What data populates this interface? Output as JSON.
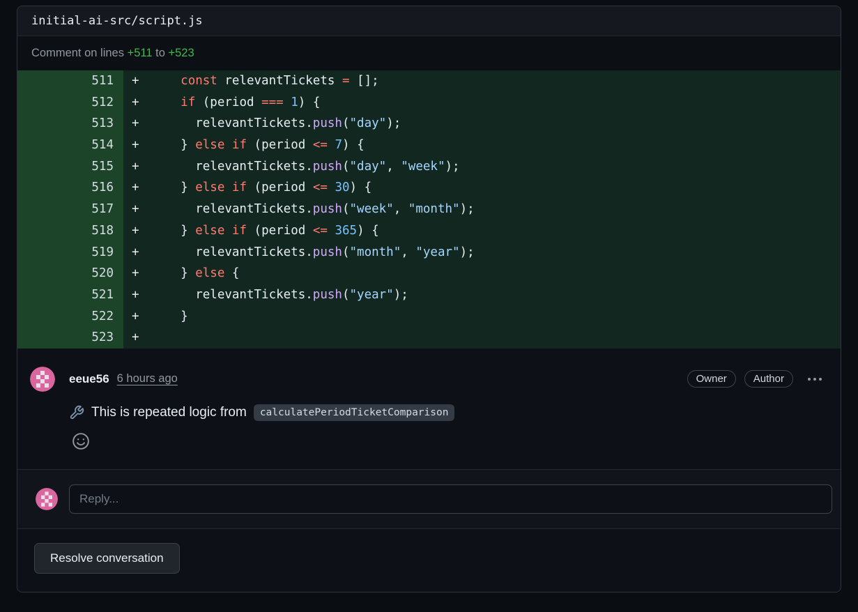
{
  "colors": {
    "addition_green": "#3fb950",
    "addition_line_bg": "#12271f",
    "addition_gutter_bg": "#1c4428",
    "keyword_red": "#ff7b72",
    "string_blue": "#a5d6ff",
    "number_blue": "#79c0fd",
    "function_purple": "#d2a8ff",
    "avatar_pink": "#d9669f"
  },
  "file_header": {
    "path": "initial-ai-src/script.js"
  },
  "lines_header": {
    "prefix": "Comment on lines",
    "start": "+511",
    "connector": "to",
    "end": "+523"
  },
  "code": {
    "language": "javascript",
    "lines": [
      {
        "num": "511",
        "sign": "+",
        "tokens": [
          [
            "pl",
            "    "
          ],
          [
            "kw",
            "const"
          ],
          [
            "pl",
            " relevantTickets "
          ],
          [
            "kw",
            "="
          ],
          [
            "pl",
            " [];"
          ]
        ]
      },
      {
        "num": "512",
        "sign": "+",
        "tokens": [
          [
            "pl",
            "    "
          ],
          [
            "kw",
            "if"
          ],
          [
            "pl",
            " (period "
          ],
          [
            "kw",
            "==="
          ],
          [
            "pl",
            " "
          ],
          [
            "num",
            "1"
          ],
          [
            "pl",
            ") {"
          ]
        ]
      },
      {
        "num": "513",
        "sign": "+",
        "tokens": [
          [
            "pl",
            "      relevantTickets."
          ],
          [
            "fn",
            "push"
          ],
          [
            "pl",
            "("
          ],
          [
            "str",
            "\"day\""
          ],
          [
            "pl",
            ");"
          ]
        ]
      },
      {
        "num": "514",
        "sign": "+",
        "tokens": [
          [
            "pl",
            "    } "
          ],
          [
            "kw",
            "else"
          ],
          [
            "pl",
            " "
          ],
          [
            "kw",
            "if"
          ],
          [
            "pl",
            " (period "
          ],
          [
            "kw",
            "<="
          ],
          [
            "pl",
            " "
          ],
          [
            "num",
            "7"
          ],
          [
            "pl",
            ") {"
          ]
        ]
      },
      {
        "num": "515",
        "sign": "+",
        "tokens": [
          [
            "pl",
            "      relevantTickets."
          ],
          [
            "fn",
            "push"
          ],
          [
            "pl",
            "("
          ],
          [
            "str",
            "\"day\""
          ],
          [
            "pl",
            ", "
          ],
          [
            "str",
            "\"week\""
          ],
          [
            "pl",
            ");"
          ]
        ]
      },
      {
        "num": "516",
        "sign": "+",
        "tokens": [
          [
            "pl",
            "    } "
          ],
          [
            "kw",
            "else"
          ],
          [
            "pl",
            " "
          ],
          [
            "kw",
            "if"
          ],
          [
            "pl",
            " (period "
          ],
          [
            "kw",
            "<="
          ],
          [
            "pl",
            " "
          ],
          [
            "num",
            "30"
          ],
          [
            "pl",
            ") {"
          ]
        ]
      },
      {
        "num": "517",
        "sign": "+",
        "tokens": [
          [
            "pl",
            "      relevantTickets."
          ],
          [
            "fn",
            "push"
          ],
          [
            "pl",
            "("
          ],
          [
            "str",
            "\"week\""
          ],
          [
            "pl",
            ", "
          ],
          [
            "str",
            "\"month\""
          ],
          [
            "pl",
            ");"
          ]
        ]
      },
      {
        "num": "518",
        "sign": "+",
        "tokens": [
          [
            "pl",
            "    } "
          ],
          [
            "kw",
            "else"
          ],
          [
            "pl",
            " "
          ],
          [
            "kw",
            "if"
          ],
          [
            "pl",
            " (period "
          ],
          [
            "kw",
            "<="
          ],
          [
            "pl",
            " "
          ],
          [
            "num",
            "365"
          ],
          [
            "pl",
            ") {"
          ]
        ]
      },
      {
        "num": "519",
        "sign": "+",
        "tokens": [
          [
            "pl",
            "      relevantTickets."
          ],
          [
            "fn",
            "push"
          ],
          [
            "pl",
            "("
          ],
          [
            "str",
            "\"month\""
          ],
          [
            "pl",
            ", "
          ],
          [
            "str",
            "\"year\""
          ],
          [
            "pl",
            ");"
          ]
        ]
      },
      {
        "num": "520",
        "sign": "+",
        "tokens": [
          [
            "pl",
            "    } "
          ],
          [
            "kw",
            "else"
          ],
          [
            "pl",
            " {"
          ]
        ]
      },
      {
        "num": "521",
        "sign": "+",
        "tokens": [
          [
            "pl",
            "      relevantTickets."
          ],
          [
            "fn",
            "push"
          ],
          [
            "pl",
            "("
          ],
          [
            "str",
            "\"year\""
          ],
          [
            "pl",
            ");"
          ]
        ]
      },
      {
        "num": "522",
        "sign": "+",
        "tokens": [
          [
            "pl",
            "    }"
          ]
        ]
      },
      {
        "num": "523",
        "sign": "+",
        "tokens": []
      }
    ]
  },
  "comment": {
    "username": "eeue56",
    "timestamp": "6 hours ago",
    "badges": [
      "Owner",
      "Author"
    ],
    "icons": {
      "body": "wrench-icon",
      "reaction": "smiley-icon",
      "menu": "kebab-icon"
    },
    "body_text": "This is repeated logic from",
    "body_code": "calculatePeriodTicketComparison"
  },
  "reply": {
    "placeholder": "Reply..."
  },
  "actions": {
    "resolve_label": "Resolve conversation"
  }
}
